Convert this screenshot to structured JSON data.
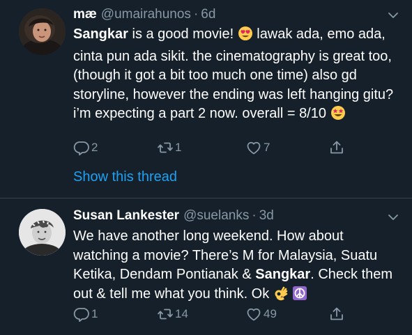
{
  "tweets": [
    {
      "name": "mæ",
      "handle": "@umairahunos",
      "separator": "·",
      "time": "6d",
      "text_bold": "Sangkar",
      "text_1": " is a good movie! ",
      "text_2": " lawak ada, emo ada, cinta pun ada sikit. the cinematography is great too, (though it got a bit too much one time) also gd storyline, however the ending was left hanging gitu? i’m expecting a part 2 now. overall = 8/10 ",
      "emoji_1": "heart-eyes-emoji",
      "emoji_2": "star-struck-emoji",
      "replies": "2",
      "retweets": "1",
      "likes": "7",
      "show_thread": "Show this thread"
    },
    {
      "name": "Susan Lankester",
      "handle": "@suelanks",
      "separator": "·",
      "time": "3d",
      "text_1": "We have another long weekend. How about watching a movie? There’s M for Malaysia, Suatu Ketika, Dendam Pontianak & ",
      "text_bold": "Sangkar",
      "text_2": ". Check them out & tell me what you think. Ok ",
      "emoji_1": "ok-hand-emoji",
      "emoji_2": "peace-symbol-emoji",
      "replies": "1",
      "retweets": "14",
      "likes": "49"
    }
  ],
  "colors": {
    "background": "#15202b",
    "secondary_text": "#8899a6",
    "link": "#1da1f2",
    "divider": "#38444d"
  }
}
